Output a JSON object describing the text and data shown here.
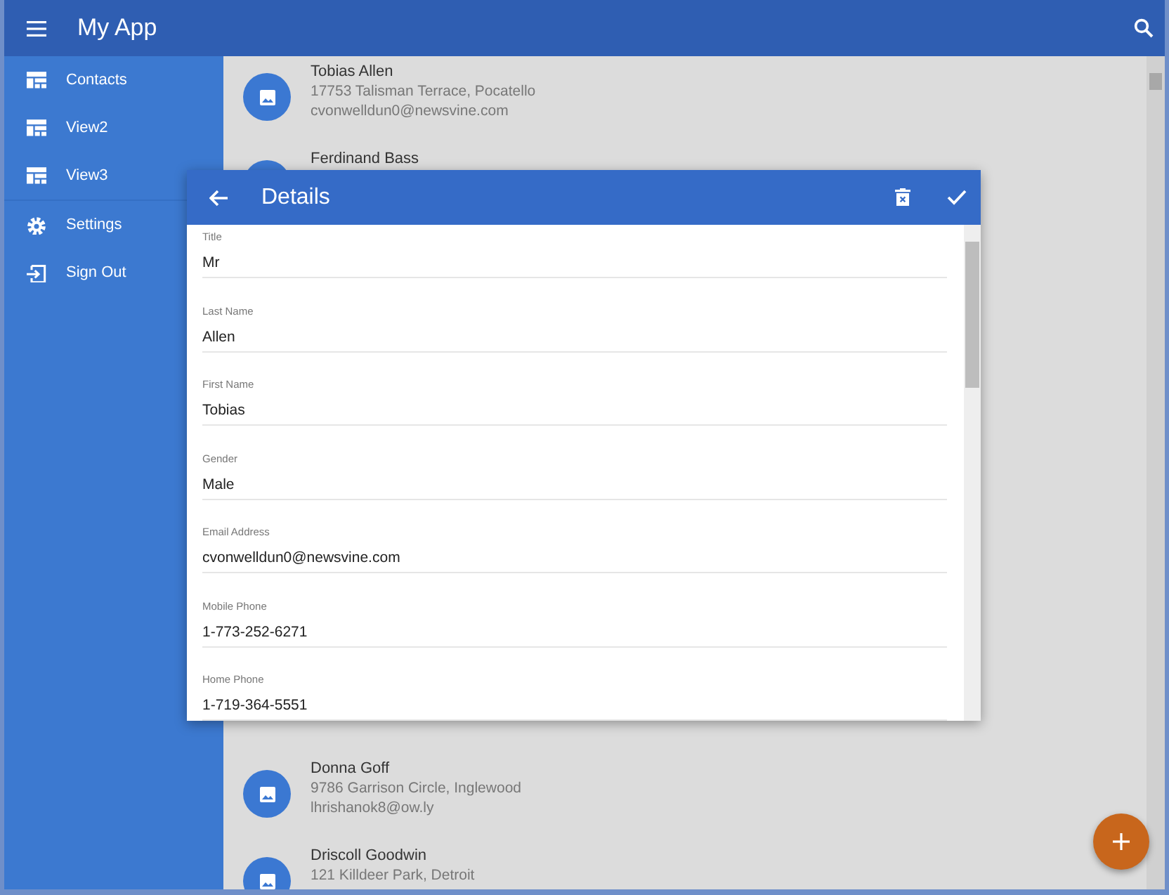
{
  "app_bar": {
    "title": "My App"
  },
  "sidebar": {
    "items": [
      {
        "label": "Contacts",
        "kind": "view"
      },
      {
        "label": "View2",
        "kind": "view"
      },
      {
        "label": "View3",
        "kind": "view"
      },
      {
        "label": "Settings",
        "kind": "settings"
      },
      {
        "label": "Sign Out",
        "kind": "signout"
      }
    ]
  },
  "contacts": {
    "rows": [
      {
        "name": "Tobias Allen",
        "address": "17753 Talisman Terrace, Pocatello",
        "email": "cvonwelldun0@newsvine.com"
      },
      {
        "name": "Ferdinand Bass"
      }
    ]
  },
  "contacts_below_dialog": {
    "rows": [
      {
        "name": "Donna Goff",
        "address": "9786 Garrison Circle, Inglewood",
        "email": "lhrishanok8@ow.ly"
      },
      {
        "name": "Driscoll Goodwin",
        "address": "121 Killdeer Park, Detroit"
      }
    ]
  },
  "dialog": {
    "title": "Details",
    "fields": [
      {
        "label": "Title",
        "value": "Mr"
      },
      {
        "label": "Last Name",
        "value": "Allen"
      },
      {
        "label": "First Name",
        "value": "Tobias"
      },
      {
        "label": "Gender",
        "value": "Male"
      },
      {
        "label": "Email Address",
        "value": "cvonwelldun0@newsvine.com"
      },
      {
        "label": "Mobile Phone",
        "value": "1-773-252-6271"
      },
      {
        "label": "Home Phone",
        "value": "1-719-364-5551"
      }
    ]
  }
}
